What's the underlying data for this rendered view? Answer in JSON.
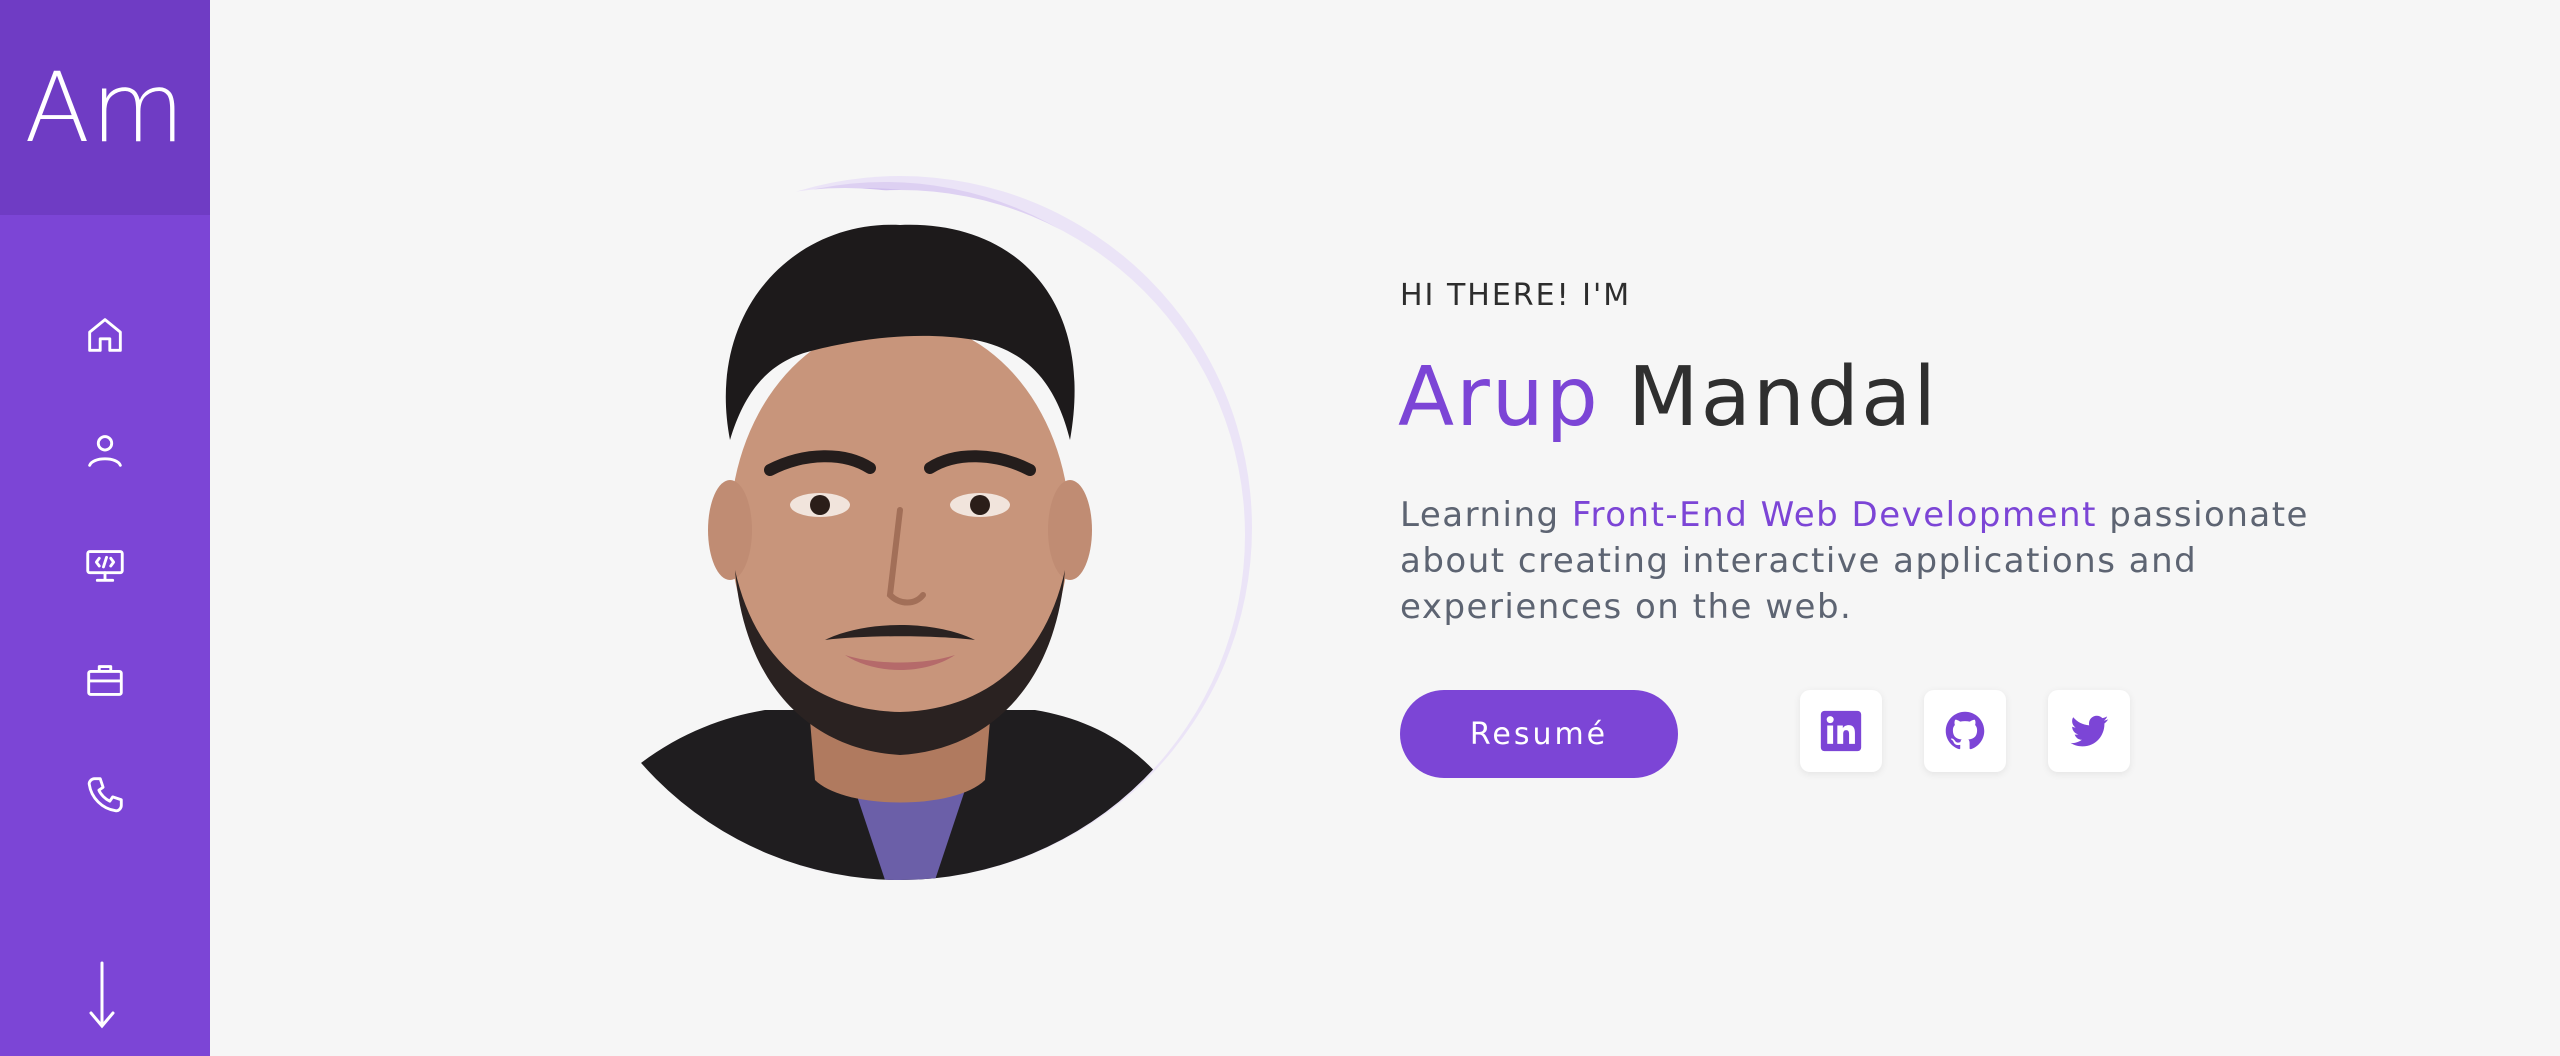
{
  "brand": {
    "logo_text": "Am"
  },
  "nav": {
    "items": [
      {
        "icon": "home-icon"
      },
      {
        "icon": "user-icon"
      },
      {
        "icon": "monitor-code-icon"
      },
      {
        "icon": "briefcase-icon"
      },
      {
        "icon": "phone-icon"
      }
    ],
    "scroll_icon": "arrow-down-icon"
  },
  "hero": {
    "greeting": "HI THERE! I'M",
    "first_name": "Arup",
    "last_name": "Mandal",
    "bio_prefix": "Learning ",
    "bio_highlight": "Front-End Web Development",
    "bio_suffix": " passionate about creating interactive applications and experiences on the web.",
    "resume_label": "Resumé"
  },
  "social": [
    {
      "name": "linkedin-icon"
    },
    {
      "name": "github-icon"
    },
    {
      "name": "twitter-icon"
    }
  ],
  "colors": {
    "accent": "#7c45d6",
    "accent_dark": "#6f3cc4",
    "background": "#f6f6f6",
    "text": "#2f2f2f",
    "muted_text": "#5d6472"
  }
}
